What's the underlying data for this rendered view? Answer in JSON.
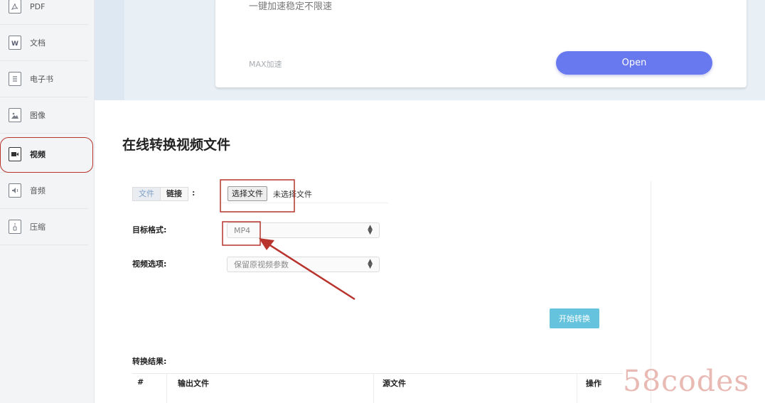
{
  "sidebar": {
    "items": [
      {
        "label": "PDF",
        "icon": "pdf-icon"
      },
      {
        "label": "文档",
        "icon": "word-document-icon"
      },
      {
        "label": "电子书",
        "icon": "ebook-icon"
      },
      {
        "label": "图像",
        "icon": "image-icon"
      },
      {
        "label": "视频",
        "icon": "video-icon",
        "active": true
      },
      {
        "label": "音频",
        "icon": "audio-icon"
      },
      {
        "label": "压缩",
        "icon": "archive-icon"
      }
    ]
  },
  "promo": {
    "description": "一键加速稳定不限速",
    "tag": "MAX加速",
    "open_label": "Open"
  },
  "main": {
    "title": "在线转换视频文件",
    "source_tabs": [
      "文件",
      "链接"
    ],
    "colon": ":",
    "file_button": "选择文件",
    "file_status": "未选择文件",
    "target_format_label": "目标格式:",
    "target_format_value": "MP4",
    "video_options_label": "视频选项:",
    "video_options_value": "保留原视频参数",
    "start_button": "开始转换",
    "results_title": "转换结果:",
    "results_columns": [
      "#",
      "输出文件",
      "源文件",
      "操作"
    ]
  },
  "watermark": "58codes",
  "colors": {
    "accent": "#6878ee",
    "start_button": "#66c3de",
    "annotation_red": "#b8332c"
  }
}
